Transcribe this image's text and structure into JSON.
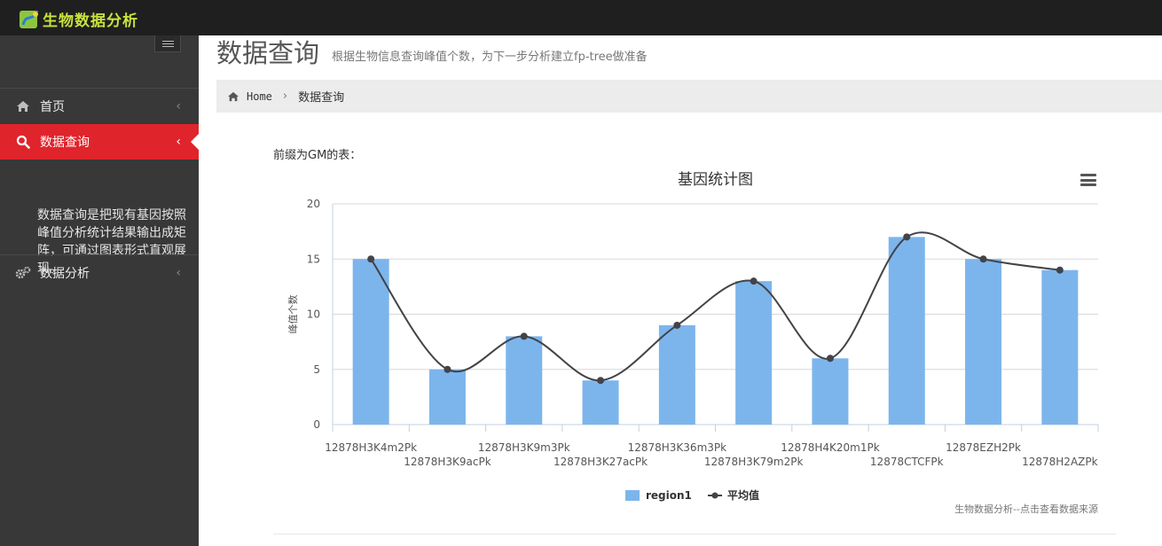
{
  "app": {
    "logo_text": "生物数据分析"
  },
  "sidebar": {
    "items": [
      {
        "label": "首页",
        "icon": "home-icon"
      },
      {
        "label": "数据查询",
        "icon": "search-icon",
        "active": true
      },
      {
        "label": "数据分析",
        "icon": "gears-icon"
      }
    ],
    "description": "数据查询是把现有基因按照峰值分析统计结果输出成矩阵，可通过图表形式直观展现。"
  },
  "header": {
    "title": "数据查询",
    "subtitle": "根据生物信息查询峰值个数，为下一步分析建立fp-tree做准备"
  },
  "breadcrumb": {
    "home": "Home",
    "current": "数据查询"
  },
  "content": {
    "table_label": "前缀为GM的表："
  },
  "colors": {
    "accent": "#e0242b",
    "bar": "#7cb5ec",
    "line": "#434348",
    "sidebar_bg": "#383838",
    "topbar_bg": "#1f1f1f"
  },
  "chart_data": {
    "type": "bar",
    "title": "基因统计图",
    "ylabel": "峰值个数",
    "xlabel": "",
    "ylim": [
      0,
      20
    ],
    "yticks": [
      0,
      5,
      10,
      15,
      20
    ],
    "categories": [
      "12878H3K4m2Pk",
      "12878H3K9acPk",
      "12878H3K9m3Pk",
      "12878H3K27acPk",
      "12878H3K36m3Pk",
      "12878H3K79m2Pk",
      "12878H4K20m1Pk",
      "12878CTCFPk",
      "12878EZH2Pk",
      "12878H2AZPk"
    ],
    "series": [
      {
        "name": "region1",
        "type": "bar",
        "values": [
          15,
          5,
          8,
          4,
          9,
          13,
          6,
          17,
          15,
          14
        ]
      },
      {
        "name": "平均值",
        "type": "line",
        "values": [
          15,
          5,
          8,
          4,
          9,
          13,
          6,
          17,
          15,
          14
        ]
      }
    ],
    "grid": true,
    "legend": "bottom-center",
    "credits": "生物数据分析--点击查看数据来源"
  }
}
